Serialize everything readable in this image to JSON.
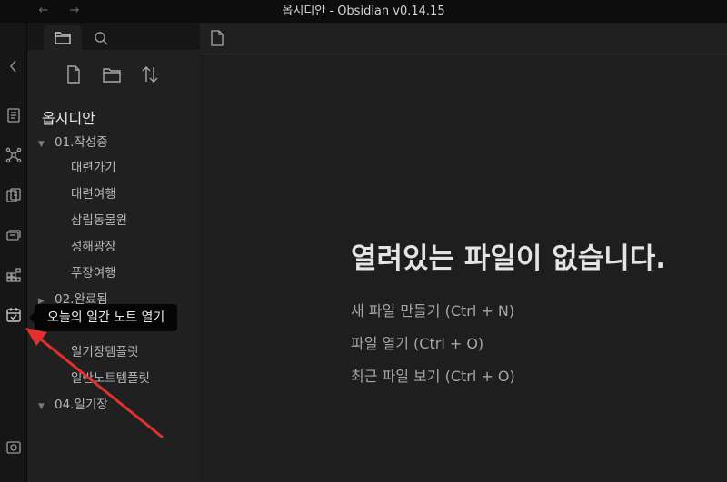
{
  "window": {
    "title": "옵시디안 - Obsidian v0.14.15"
  },
  "sidebar": {
    "vault_name": "옵시디안",
    "tree": [
      {
        "type": "folder",
        "label": "01.작성중",
        "expanded": true
      },
      {
        "type": "file",
        "label": "대련가기"
      },
      {
        "type": "file",
        "label": "대련여행"
      },
      {
        "type": "file",
        "label": "삼립동물원"
      },
      {
        "type": "file",
        "label": "성해광장"
      },
      {
        "type": "file",
        "label": "푸장여행"
      },
      {
        "type": "folder",
        "label": "02.완료됨",
        "expanded": false
      },
      {
        "type": "file",
        "label": "일기장템플릿"
      },
      {
        "type": "file",
        "label": "일반노트템플릿"
      },
      {
        "type": "folder",
        "label": "04.일기장",
        "expanded": true
      }
    ]
  },
  "main": {
    "empty_title": "열려있는 파일이 없습니다.",
    "actions": [
      "새 파일 만들기 (Ctrl + N)",
      "파일 열기 (Ctrl + O)",
      "최근 파일 보기 (Ctrl + O)"
    ]
  },
  "tooltip": {
    "text": "오늘의 일간 노트 열기"
  },
  "colors": {
    "annotation_arrow": "#e0312f",
    "background": "#1e1e1e",
    "sidebar": "#202020"
  }
}
